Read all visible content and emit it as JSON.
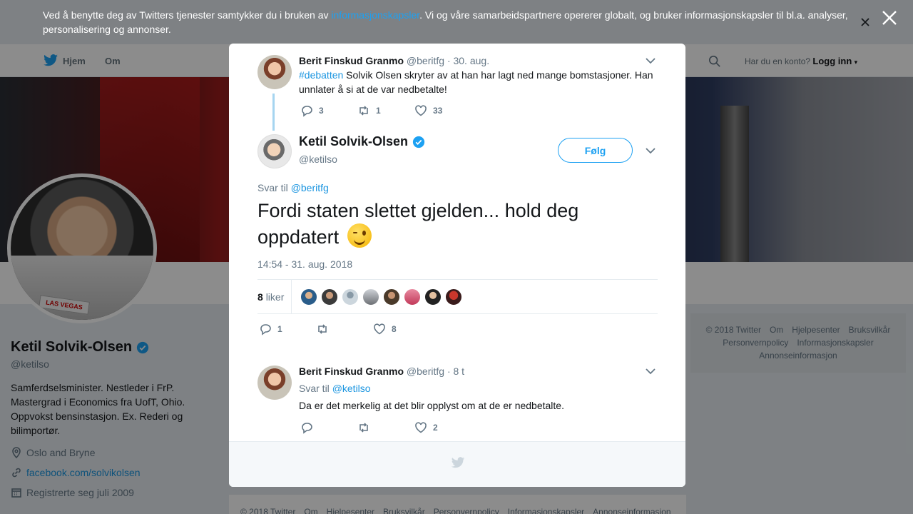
{
  "cookie_banner": {
    "text_before": "Ved å benytte deg av Twitters tjenester samtykker du i bruken av ",
    "link": "informasjonskapsler",
    "text_after": ". Vi og våre samarbeidspartnere opererer globalt, og bruker informasjonskapsler til bl.a. analyser, personalisering og annonser."
  },
  "nav": {
    "home": "Hjem",
    "about": "Om",
    "account_prompt": "Har du en konto?",
    "login": "Logg inn"
  },
  "profile": {
    "name": "Ketil Solvik-Olsen",
    "handle": "@ketilso",
    "bio": "Samferdselsminister. Nestleder i FrP. Mastergrad i Economics fra UofT, Ohio. Oppvokst bensinstasjon. Ex. Rederi og bilimportør.",
    "location": "Oslo and Bryne",
    "website": "facebook.com/solvikolsen",
    "joined": "Registrerte seg juli 2009",
    "plate": "LAS VEGAS"
  },
  "side_footer": {
    "items": [
      "© 2018 Twitter",
      "Om",
      "Hjelpesenter",
      "Bruksvilkår",
      "Personvernpolicy",
      "Informasjonskapsler",
      "Annonseinformasjon"
    ]
  },
  "page_footer": {
    "items": [
      "© 2018 Twitter",
      "Om",
      "Hjelpesenter",
      "Bruksvilkår",
      "Personvernpolicy",
      "Informasjonskapsler",
      "Annonseinformasjon"
    ]
  },
  "modal": {
    "parent_tweet": {
      "name": "Berit Finskud Granmo",
      "handle": "@beritfg",
      "date": "· 30. aug.",
      "hashtag": "#debatten",
      "text": " Solvik Olsen skryter av at han har lagt ned mange bomstasjoner. Han unnlater å si at de var nedbetalte!",
      "replies": "3",
      "retweets": "1",
      "likes": "33"
    },
    "main_tweet": {
      "name": "Ketil Solvik-Olsen",
      "handle": "@ketilso",
      "follow": "Følg",
      "reply_prefix": "Svar til",
      "reply_to": "@beritfg",
      "text": "Fordi staten slettet gjelden... hold deg oppdatert",
      "timestamp": "14:54 - 31. aug. 2018",
      "like_count": "8",
      "like_label": "liker",
      "replies": "1",
      "retweets": "",
      "likes": "8"
    },
    "reply_tweet": {
      "name": "Berit Finskud Granmo",
      "handle": "@beritfg",
      "date": "· 8 t",
      "reply_prefix": "Svar til",
      "reply_to": "@ketilso",
      "text": "Da er det merkelig at det blir opplyst om at de er nedbetalte.",
      "replies": "",
      "retweets": "",
      "likes": "2"
    }
  },
  "colors": {
    "accent": "#1da1f2",
    "link": "#1b95e0",
    "muted": "#657786"
  }
}
